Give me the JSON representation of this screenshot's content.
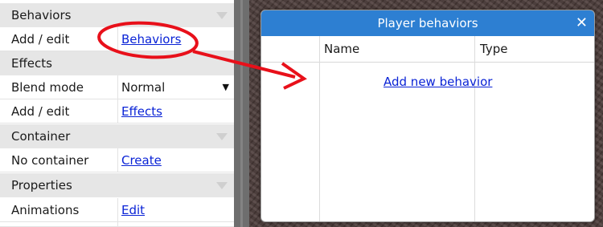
{
  "properties": {
    "sections": {
      "behaviors": "Behaviors",
      "effects": "Effects",
      "container": "Container",
      "properties": "Properties"
    },
    "rows": {
      "behaviors_edit": {
        "name": "Add / edit",
        "value": "Behaviors"
      },
      "blend_mode": {
        "name": "Blend mode",
        "value": "Normal"
      },
      "effects_edit": {
        "name": "Add / edit",
        "value": "Effects"
      },
      "container": {
        "name": "No container",
        "value": "Create"
      },
      "animations": {
        "name": "Animations",
        "value": "Edit"
      }
    }
  },
  "dialog": {
    "title": "Player behaviors",
    "close": "✕",
    "columns": {
      "name": "Name",
      "type": "Type"
    },
    "add_new": "Add new behavior"
  },
  "annotation": {
    "color": "#e8101a"
  }
}
